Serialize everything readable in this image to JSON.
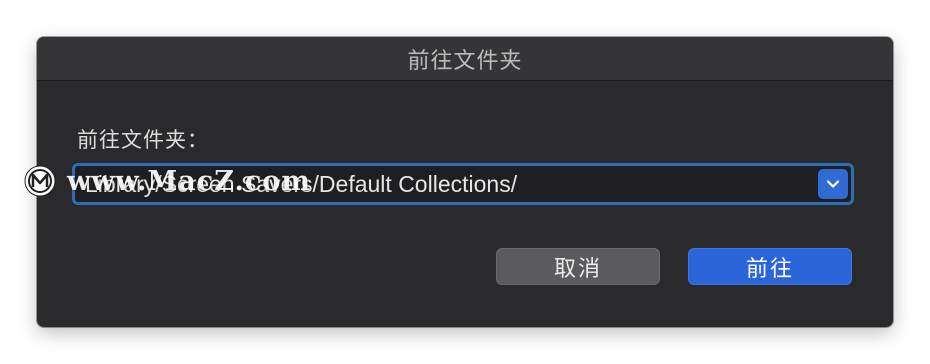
{
  "dialog": {
    "title": "前往文件夹",
    "prompt_label": "前往文件夹：",
    "path_value": "Library/Screen Savers/Default Collections/",
    "cancel_label": "取消",
    "go_label": "前往"
  },
  "watermark": {
    "text": "www.MacZ.com"
  },
  "colors": {
    "dialog_bg": "#2a2a2c",
    "accent_blue": "#2a66d9",
    "focus_ring": "#2d6db5"
  },
  "icons": {
    "dropdown": "chevron-down-icon",
    "watermark_logo": "macz-logo-icon"
  }
}
